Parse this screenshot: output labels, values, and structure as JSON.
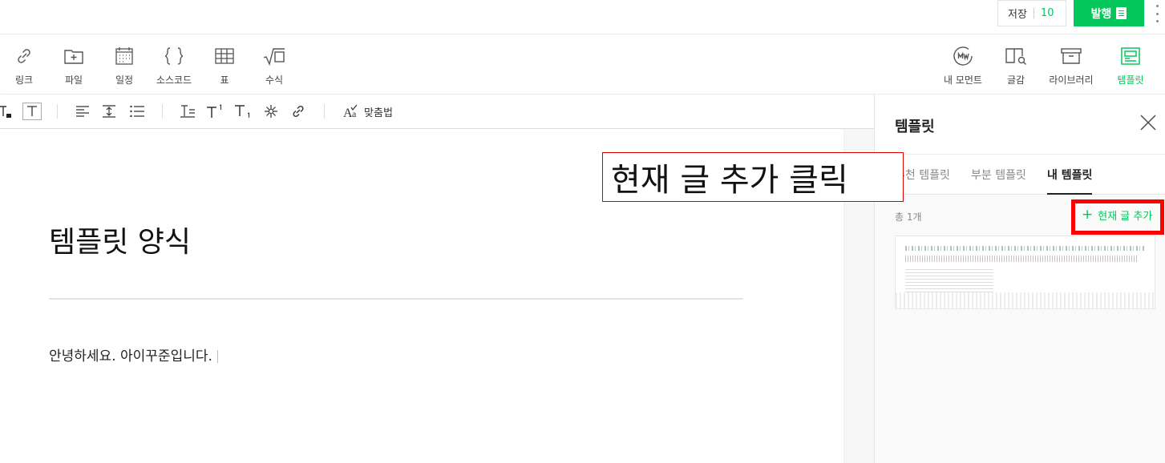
{
  "topbar": {
    "save_label": "저장",
    "save_count": "10",
    "publish_label": "발행"
  },
  "insert_toolbar": {
    "left": [
      {
        "label": "링크",
        "icon": "link-icon"
      },
      {
        "label": "파일",
        "icon": "file-icon"
      },
      {
        "label": "일정",
        "icon": "calendar-icon"
      },
      {
        "label": "소스코드",
        "icon": "code-icon"
      },
      {
        "label": "표",
        "icon": "table-icon"
      },
      {
        "label": "수식",
        "icon": "formula-icon"
      }
    ],
    "right": [
      {
        "label": "내 모먼트",
        "icon": "moment-icon"
      },
      {
        "label": "글감",
        "icon": "material-icon"
      },
      {
        "label": "라이브러리",
        "icon": "library-icon"
      },
      {
        "label": "템플릿",
        "icon": "template-icon",
        "active": true
      }
    ]
  },
  "format_toolbar": {
    "fit_label": "맞춤법"
  },
  "editor": {
    "title": "템플릿 양식",
    "body": "안녕하세요. 아이꾸준입니다."
  },
  "template_panel": {
    "title": "템플릿",
    "tabs": [
      "추천 템플릿",
      "부분 템플릿",
      "내 템플릿"
    ],
    "active_tab": "내 템플릿",
    "total": "총 1개",
    "add_current": "현재 글 추가"
  },
  "annotation": {
    "caption": "현재 글 추가 클릭",
    "highlight_color": "#ff0000"
  },
  "colors": {
    "accent": "#03c75a"
  }
}
